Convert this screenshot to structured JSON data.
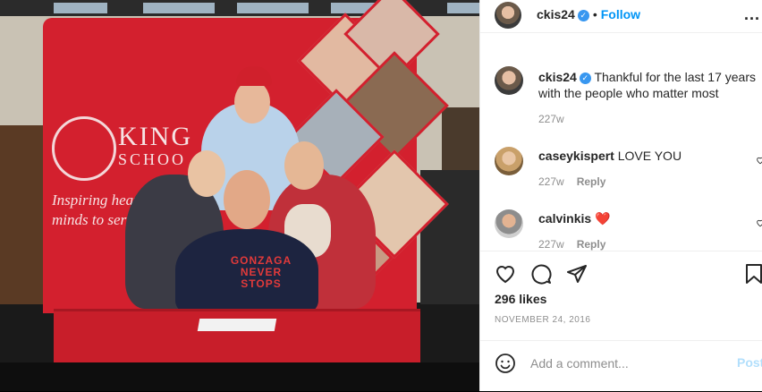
{
  "post": {
    "photo": {
      "banner_logo_text": "KING",
      "banner_logo_sub": "SCHOO",
      "tagline_line1": "Inspiring heart",
      "tagline_line2": "minds to serv",
      "shirt_text": "GONZAGA NEVER STOPS"
    },
    "header": {
      "username": "ckis24",
      "verified_glyph": "✓",
      "separator": "•",
      "follow_label": "Follow",
      "more_label": "..."
    },
    "caption": {
      "username": "ckis24",
      "verified_glyph": "✓",
      "text": "Thankful for the last 17 years with the people who matter most",
      "age": "227w"
    },
    "comments": [
      {
        "username": "caseykispert",
        "text": "LOVE YOU",
        "age": "227w",
        "reply_label": "Reply"
      },
      {
        "username": "calvinkis",
        "text": "❤️",
        "age": "227w",
        "reply_label": "Reply"
      }
    ],
    "actions": {
      "icons": [
        "heart-icon",
        "comment-icon",
        "share-icon",
        "bookmark-icon"
      ]
    },
    "likes": "296 likes",
    "date": "NOVEMBER 24, 2016",
    "add_comment": {
      "placeholder": "Add a comment...",
      "post_label": "Post"
    },
    "colors": {
      "accent": "#0095f6",
      "verified": "#3897f0",
      "banner_red": "#d3202e"
    }
  }
}
